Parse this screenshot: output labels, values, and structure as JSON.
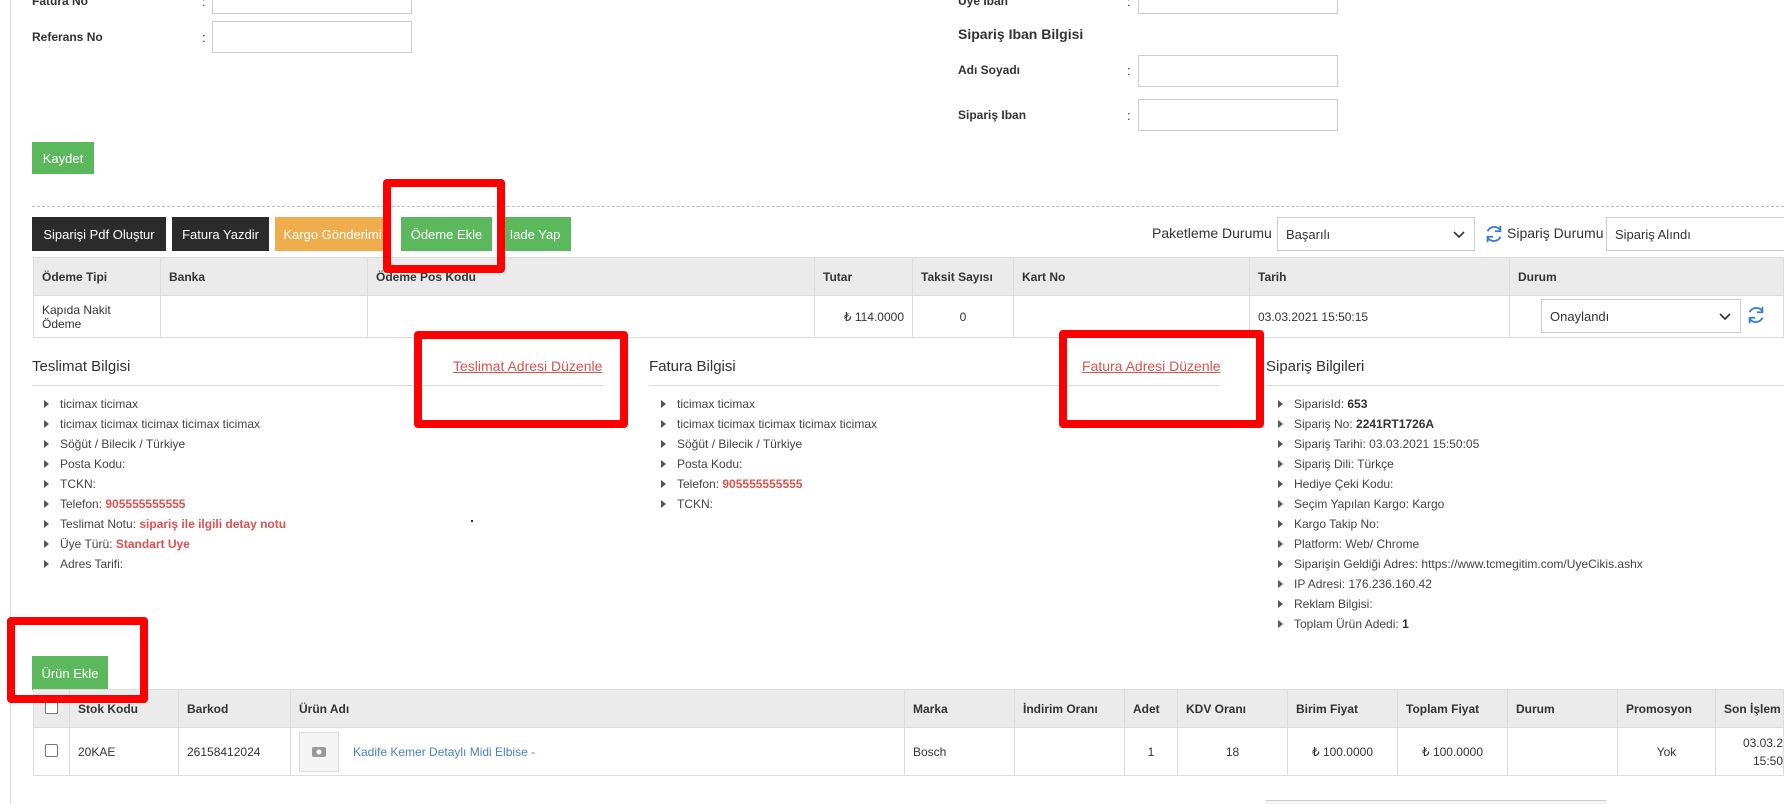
{
  "form": {
    "fatura_no_label": "Fatura No",
    "referans_label": "Referans No",
    "uye_iban_label": "Üye Iban",
    "iban_section_title": "Sipariş Iban Bilgisi",
    "adi_soyadi_label": "Adı Soyadı",
    "siparis_iban_label": "Sipariş Iban",
    "colon": ":",
    "save_label": "Kaydet"
  },
  "toolbar": {
    "pdf_label": "Siparişi Pdf Oluştur",
    "fatura_label": "Fatura Yazdir",
    "kargo_label": "Kargo Gönderimi",
    "odeme_label": "Ödeme Ekle",
    "iade_label": "Iade Yap",
    "paketleme_label": "Paketleme Durumu",
    "paketleme_value": "Başarılı",
    "siparis_durumu_label": "Sipariş Durumu",
    "siparis_durumu_value": "Sipariş Alındı"
  },
  "payments": {
    "headers": [
      "Ödeme Tipi",
      "Banka",
      "Ödeme Pos Kodu",
      "Tutar",
      "Taksit Sayısı",
      "Kart No",
      "Tarih",
      "Durum"
    ],
    "rows": [
      {
        "tip": "Kapıda Nakit Ödeme",
        "banka": "",
        "pos": "",
        "currency": "₺",
        "tutar": "114.0000",
        "taksit": "0",
        "kart": "",
        "tarih": "03.03.2021 15:50:15",
        "durum": "Onaylandı"
      }
    ]
  },
  "teslimat": {
    "title": "Teslimat Bilgisi",
    "edit_link": "Teslimat Adresi Düzenle",
    "name": "ticimax ticimax",
    "address": "ticimax ticimax ticimax ticimax ticimax",
    "location": "Söğüt / Bilecik / Türkiye",
    "posta_label": "Posta Kodu:",
    "tckn_label": "TCKN:",
    "telefon_label": "Telefon:",
    "telefon_value": "905555555555",
    "not_label": "Teslimat Notu:",
    "not_value": "sipariş ile ilgili detay notu",
    "uye_turu_label": "Üye Türü:",
    "uye_turu_value": "Standart Uye",
    "adres_tarifi_label": "Adres Tarifi:"
  },
  "fatura": {
    "title": "Fatura Bilgisi",
    "edit_link": "Fatura Adresi Düzenle",
    "name": "ticimax ticimax",
    "address": "ticimax ticimax ticimax ticimax ticimax",
    "location": "Söğüt / Bilecik / Türkiye",
    "posta_label": "Posta Kodu:",
    "telefon_label": "Telefon:",
    "telefon_value": "905555555555",
    "tckn_label": "TCKN:"
  },
  "siparis": {
    "title": "Sipariş Bilgileri",
    "id_label": "SiparisId:",
    "id_value": "653",
    "no_label": "Sipariş No:",
    "no_value": "2241RT1726A",
    "tarih": "Sipariş Tarihi: 03.03.2021 15:50:05",
    "dil": "Sipariş Dili: Türkçe",
    "hediye": "Hediye Çeki Kodu:",
    "kargo": "Seçim Yapılan Kargo: Kargo",
    "takip": "Kargo Takip No:",
    "platform": "Platform: Web/ Chrome",
    "geldigi": "Siparişin Geldiği Adres: https://www.tcmegitim.com/UyeCikis.ashx",
    "ip": "IP Adresi: 176.236.160.42",
    "reklam": "Reklam Bilgisi:",
    "toplam_label": "Toplam Ürün Adedi:",
    "toplam_value": "1"
  },
  "products": {
    "add_label": "Ürün Ekle",
    "headers": [
      "Stok Kodu",
      "Barkod",
      "Ürün Adı",
      "Marka",
      "İndirim Oranı",
      "Adet",
      "KDV Oranı",
      "Birim Fiyat",
      "Toplam Fiyat",
      "Durum",
      "Promosyon",
      "Son İşlem T"
    ],
    "rows": [
      {
        "stok": "20KAE",
        "barkod": "26158412024",
        "ad": "Kadife Kemer Detaylı Midi Elbise -",
        "marka": "Bosch",
        "indirim": "",
        "adet": "1",
        "kdv": "18",
        "currency": "₺",
        "birim": "100.0000",
        "toplam": "100.0000",
        "durum": "",
        "promosyon": "Yok",
        "son_tarih": "03.03.2",
        "son_saat": "15:50"
      }
    ]
  },
  "colors": {
    "highlight": "#ff0000",
    "green": "#5cb85c",
    "dark": "#2b2b2b",
    "orange": "#f0ad4e",
    "accent_red": "#d9534f",
    "link_blue": "#4a7fc1"
  }
}
